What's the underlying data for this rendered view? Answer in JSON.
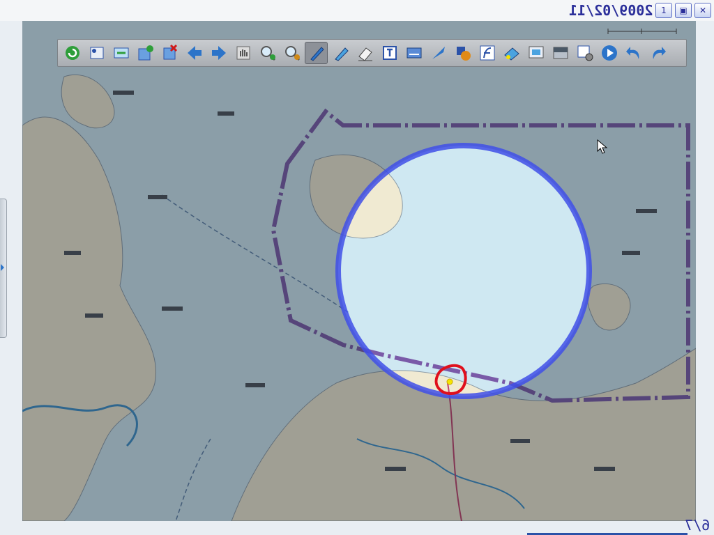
{
  "header": {
    "datetime": "2009/02/11",
    "page_label": "1"
  },
  "footer": {
    "page_counter": "6/7"
  },
  "toolbar": {
    "tools": [
      {
        "icon": "refresh-icon",
        "active": false
      },
      {
        "icon": "pages-icon",
        "active": false
      },
      {
        "icon": "sync-slides-icon",
        "active": false
      },
      {
        "icon": "add-page-icon",
        "active": false
      },
      {
        "icon": "delete-page-icon",
        "active": false
      },
      {
        "icon": "previous-arrow-icon",
        "active": false
      },
      {
        "icon": "next-arrow-icon",
        "active": false
      },
      {
        "icon": "pan-hand-icon",
        "active": false
      },
      {
        "icon": "zoom-in-icon",
        "active": false
      },
      {
        "icon": "zoom-out-icon",
        "active": false
      },
      {
        "icon": "pen-icon",
        "active": true
      },
      {
        "icon": "highlighter-icon",
        "active": false
      },
      {
        "icon": "eraser-icon",
        "active": false
      },
      {
        "icon": "text-tool-icon",
        "active": false
      },
      {
        "icon": "screen-capture-icon",
        "active": false
      },
      {
        "icon": "pointer-pen-icon",
        "active": false
      },
      {
        "icon": "shapes-icon",
        "active": false
      },
      {
        "icon": "function-icon",
        "active": false
      },
      {
        "icon": "spotlight-icon",
        "active": false
      },
      {
        "icon": "magnifier-window-icon",
        "active": false
      },
      {
        "icon": "screen-shade-icon",
        "active": false
      },
      {
        "icon": "settings-tools-icon",
        "active": false
      },
      {
        "icon": "play-icon",
        "active": false
      },
      {
        "icon": "undo-icon",
        "active": false
      },
      {
        "icon": "redo-icon",
        "active": false
      }
    ]
  },
  "map": {
    "land_color": "#f0ead2",
    "sea_color": "#cfe8f2",
    "boundary_color": "#7a5aa8",
    "spotlight_ring_color": "#3f4fe8",
    "marker_color": "#e0101c",
    "marker_dot_color": "#f5e400",
    "dim_opacity": 0.38
  }
}
